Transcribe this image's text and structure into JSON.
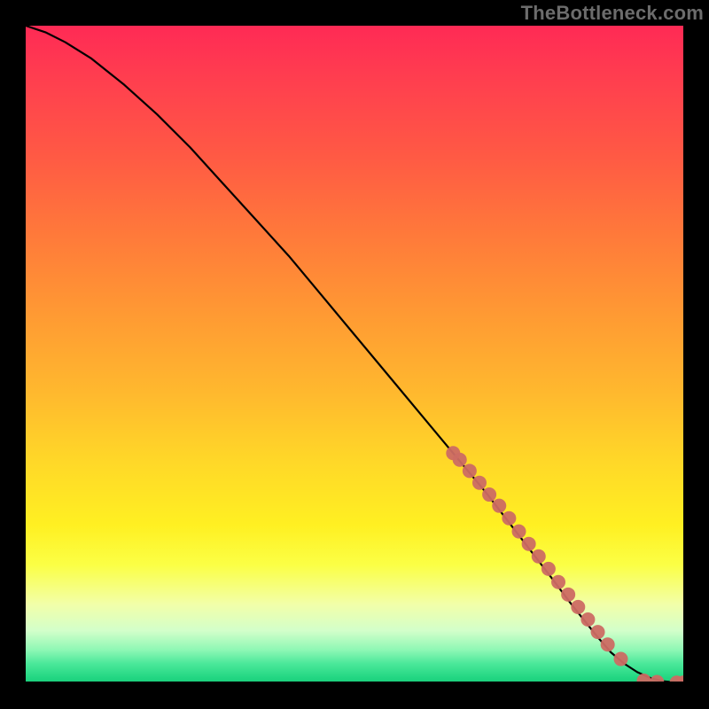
{
  "watermark": "TheBottleneck.com",
  "chart_data": {
    "type": "line",
    "title": "",
    "xlabel": "",
    "ylabel": "",
    "xlim": [
      0,
      100
    ],
    "ylim": [
      0,
      100
    ],
    "grid": false,
    "legend": false,
    "background": "gradient-red-to-green",
    "series": [
      {
        "name": "curve",
        "style": "line",
        "color": "#000000",
        "x": [
          0,
          3,
          6,
          10,
          15,
          20,
          25,
          30,
          35,
          40,
          45,
          50,
          55,
          60,
          65,
          70,
          75,
          80,
          83,
          85,
          87,
          89,
          91,
          93,
          95,
          97,
          99,
          100
        ],
        "y": [
          100,
          99,
          97.5,
          95,
          91,
          86.5,
          81.5,
          76,
          70.5,
          65,
          59,
          53,
          47,
          41,
          35,
          29,
          22.5,
          16,
          12,
          9.5,
          7,
          4.7,
          3,
          1.7,
          0.8,
          0.3,
          0.1,
          0.1
        ]
      },
      {
        "name": "markers",
        "style": "scatter",
        "color": "#cc6b63",
        "x": [
          65,
          66,
          67.5,
          69,
          70.5,
          72,
          73.5,
          75,
          76.5,
          78,
          79.5,
          81,
          82.5,
          84,
          85.5,
          87,
          88.5,
          90.5,
          94,
          96,
          99,
          100
        ],
        "y": [
          35,
          34,
          32.3,
          30.5,
          28.7,
          27,
          25.1,
          23.1,
          21.2,
          19.3,
          17.4,
          15.4,
          13.5,
          11.6,
          9.7,
          7.8,
          5.9,
          3.7,
          0.4,
          0.2,
          0.1,
          0.1
        ]
      }
    ]
  }
}
